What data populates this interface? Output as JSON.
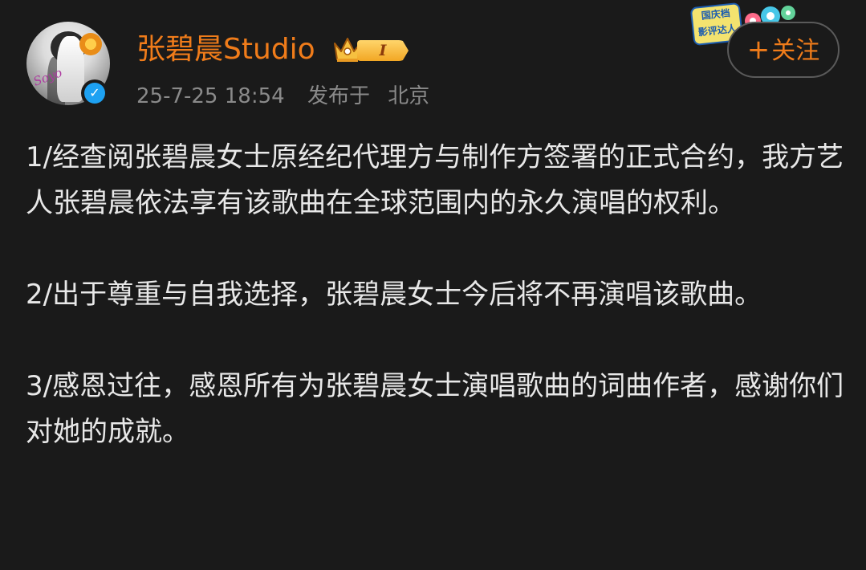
{
  "post": {
    "author": {
      "name": "张碧晨Studio",
      "level": "I",
      "verified": true,
      "avatar_icon": "user-avatar-photo"
    },
    "timestamp": "25-7-25 18:54",
    "published_label": "发布于",
    "location": "北京",
    "follow_button": {
      "plus": "+",
      "label": "关注"
    },
    "festival_badge": {
      "line1": "国庆档",
      "line2": "影评达人"
    },
    "paragraphs": [
      "1/经查阅张碧晨女士原经纪代理方与制作方签署的正式合约，我方艺人张碧晨依法享有该歌曲在全球范围内的永久演唱的权利。",
      "2/出于尊重与自我选择，张碧晨女士今后将不再演唱该歌曲。",
      "3/感恩过往，感恩所有为张碧晨女士演唱歌曲的词曲作者，感谢你们对她的成就。"
    ]
  },
  "colors": {
    "background": "#1a1a1a",
    "username": "#f07c1a",
    "follow_accent": "#f07c1a",
    "meta_text": "#8a8a8a",
    "body_text": "#e8e8e8",
    "verified": "#1da1f2",
    "level_badge": "#f2a724"
  }
}
